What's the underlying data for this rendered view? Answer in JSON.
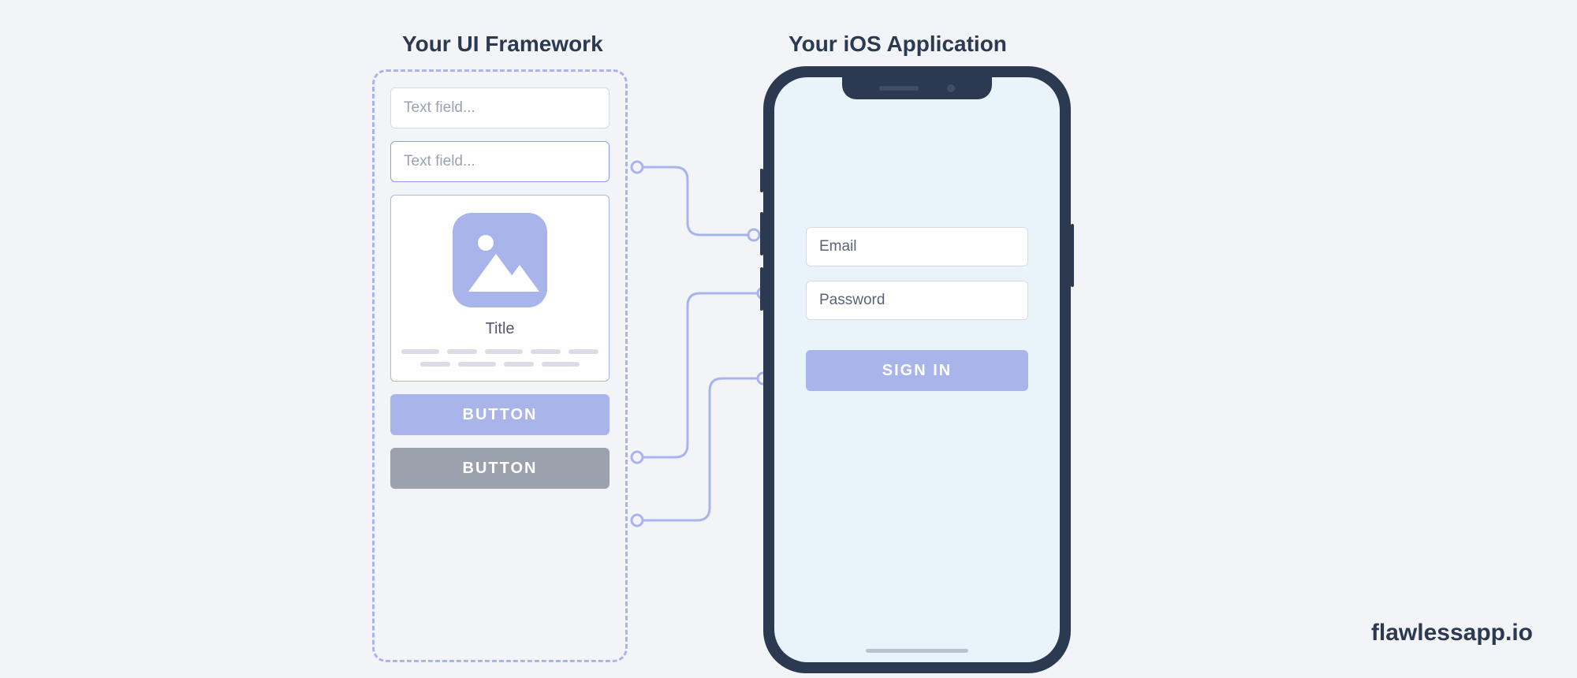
{
  "headings": {
    "framework": "Your UI Framework",
    "app": "Your iOS Application"
  },
  "framework": {
    "textfield1_placeholder": "Text field...",
    "textfield2_placeholder": "Text field...",
    "card_title": "Title",
    "button_primary_label": "BUTTON",
    "button_secondary_label": "BUTTON"
  },
  "app": {
    "email_placeholder": "Email",
    "password_placeholder": "Password",
    "signin_label": "SIGN IN"
  },
  "brand": "flawlessapp.io",
  "colors": {
    "accent": "#a9b5ea",
    "dark": "#2b3a50",
    "muted_btn": "#9ba1ad",
    "screen": "#e8f4fa"
  }
}
